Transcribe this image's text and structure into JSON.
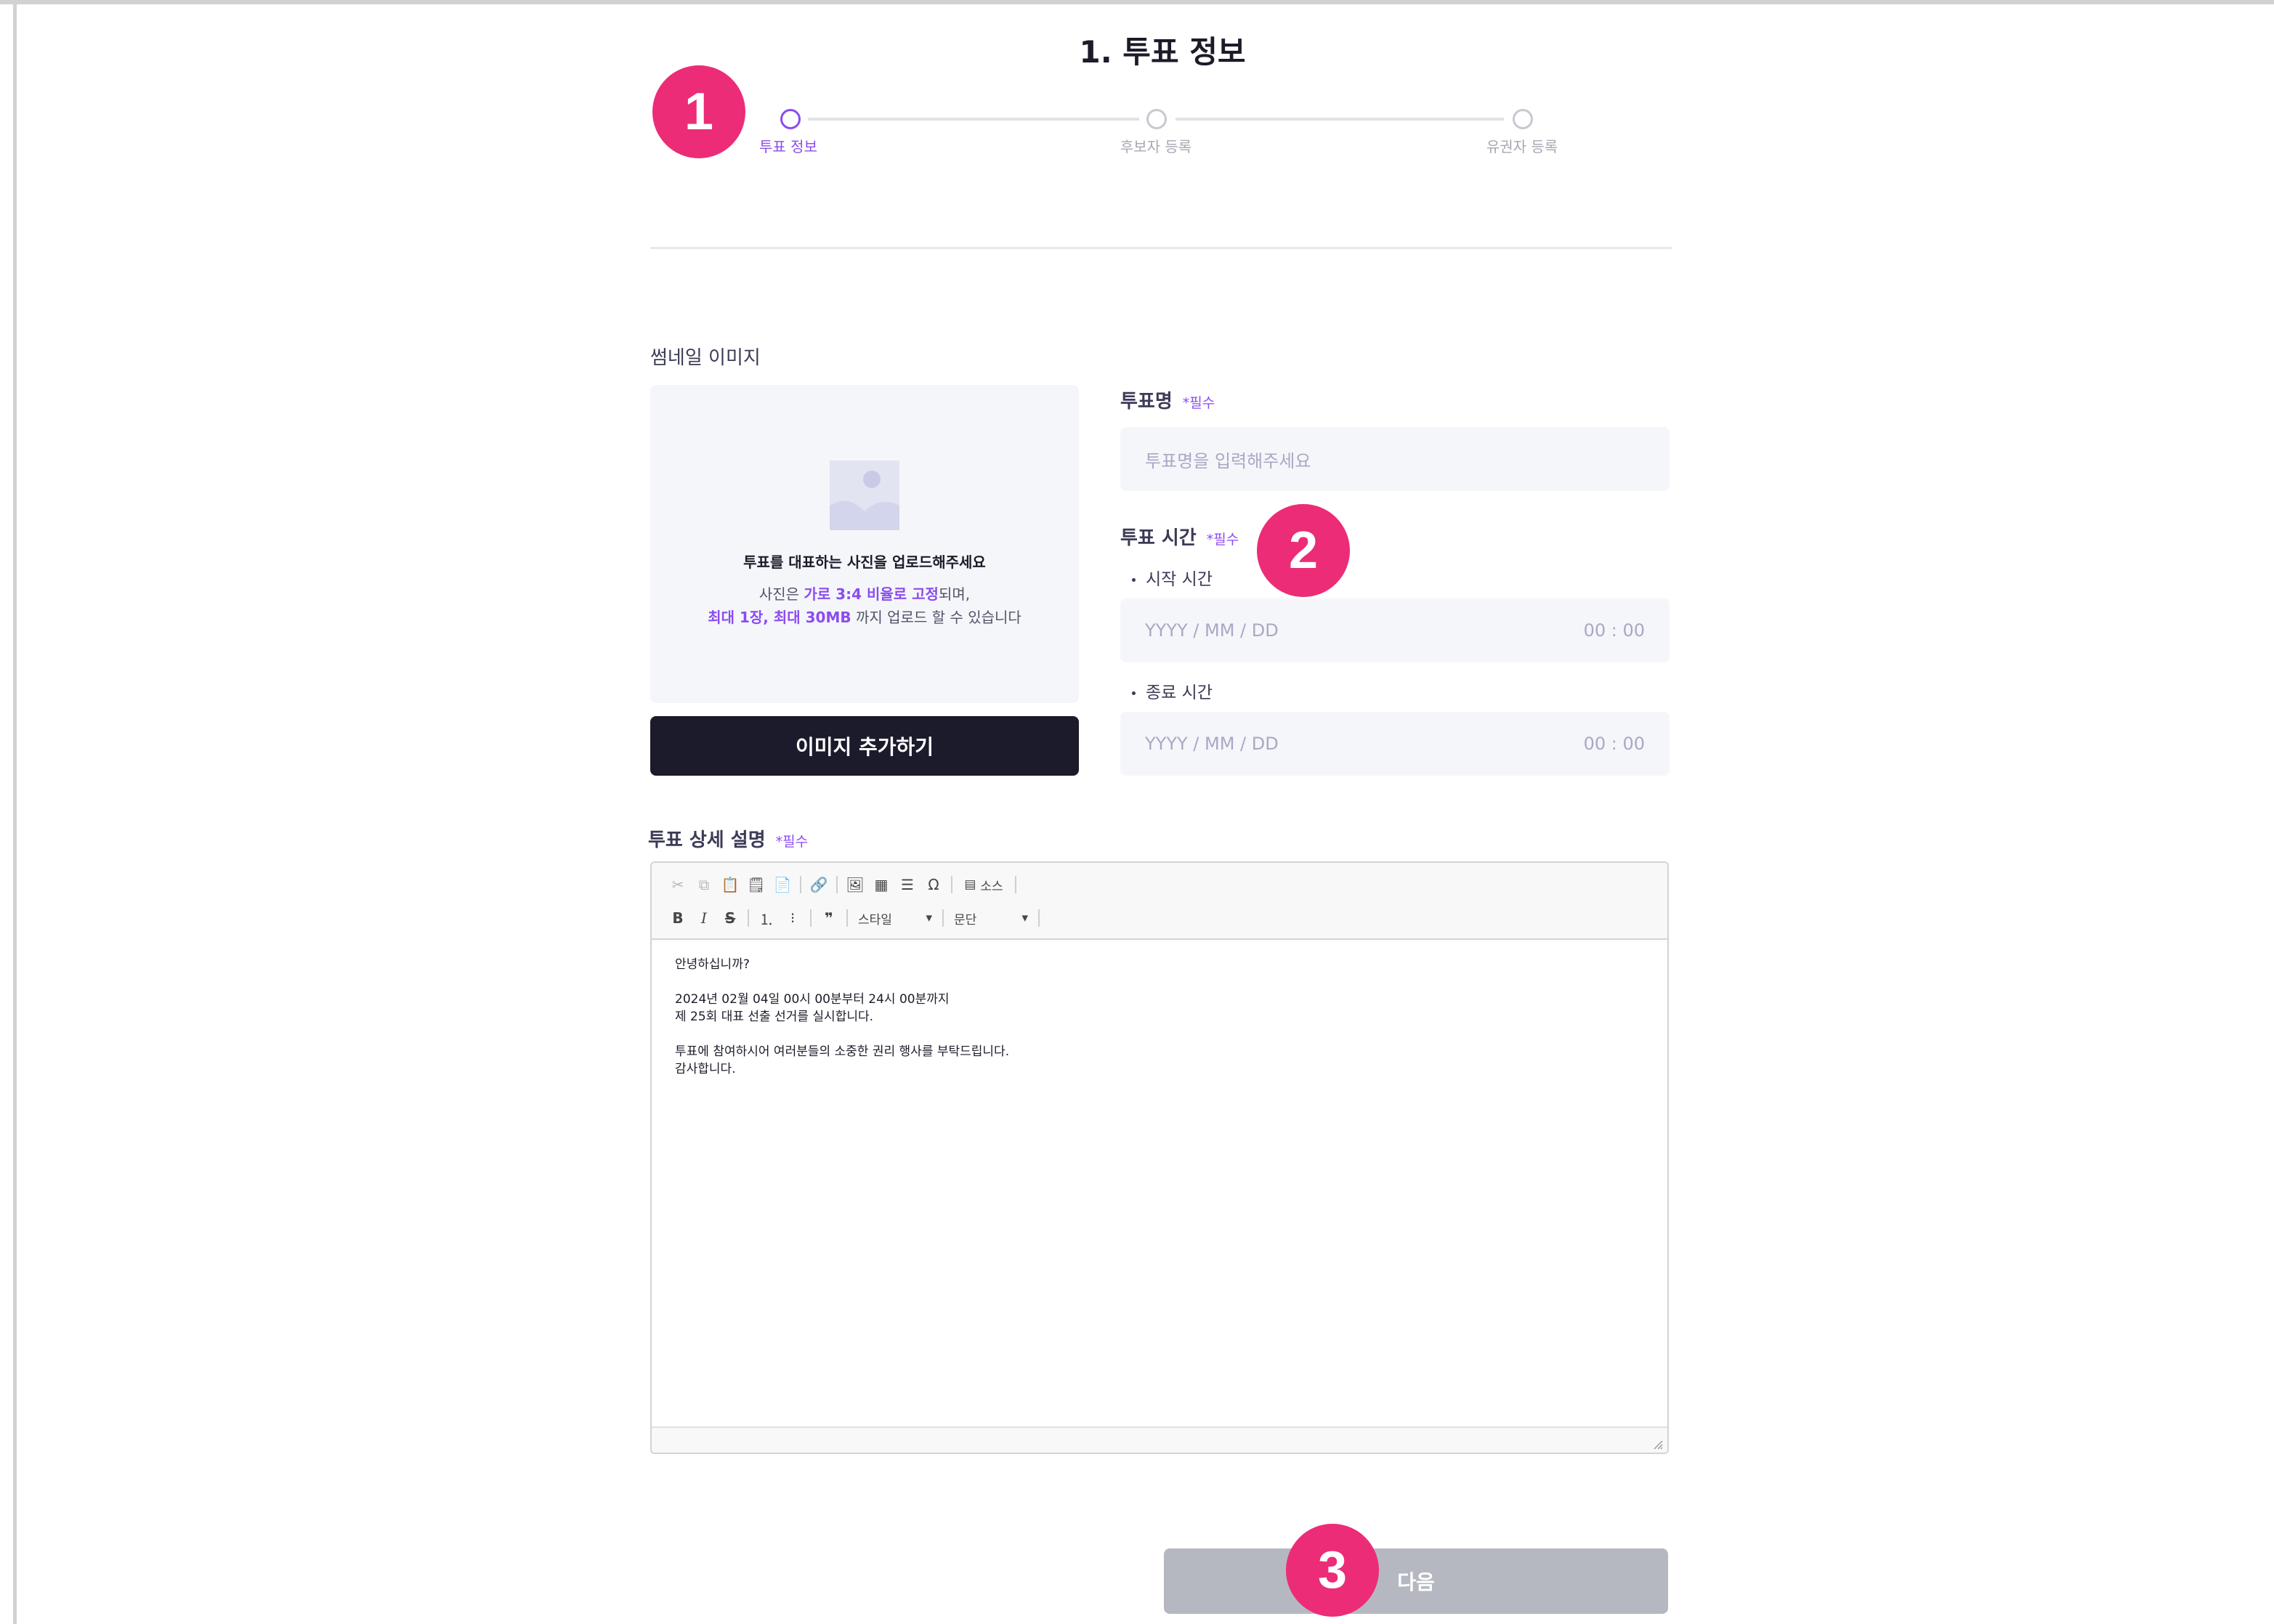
{
  "page": {
    "title": "1. 투표 정보"
  },
  "stepper": {
    "steps": [
      {
        "label": "투표 정보",
        "active": true
      },
      {
        "label": "후보자 등록",
        "active": false
      },
      {
        "label": "유권자 등록",
        "active": false
      }
    ]
  },
  "thumbnail": {
    "label": "썸네일 이미지",
    "icon": "image-placeholder-icon",
    "title": "투표를 대표하는 사진을 업로드해주세요",
    "line1_pre": "사진은 ",
    "line1_highlight": "가로 3:4 비율로 고정",
    "line1_post": "되며,",
    "line2_highlight1": "최대 1장",
    "line2_sep": ", ",
    "line2_highlight2": "최대 30MB",
    "line2_post": " 까지 업로드 할 수 있습니다",
    "button_label": "이미지 추가하기"
  },
  "vote_name": {
    "label": "투표명",
    "required": "*필수",
    "placeholder": "투표명을 입력해주세요"
  },
  "vote_time": {
    "label": "투표 시간",
    "required": "*필수",
    "start_label": "시작 시간",
    "end_label": "종료 시간",
    "date_placeholder": "YYYY / MM / DD",
    "time_placeholder": "00 : 00"
  },
  "description": {
    "label": "투표 상세 설명",
    "required": "*필수",
    "toolbar": {
      "source_label": "소스",
      "style_label": "스타일",
      "format_label": "문단"
    },
    "paragraphs": [
      "안녕하십니까?",
      "2024년 02월 04일 00시 00분부터 24시 00분까지\n제 25회 대표 선출 선거를 실시합니다.",
      "투표에 참여하시어 여러분들의 소중한 권리 행사를 부탁드립니다.\n감사합니다."
    ]
  },
  "next_button": {
    "label": "다음"
  },
  "callouts": [
    "1",
    "2",
    "3"
  ],
  "colors": {
    "accent": "#8b4cf0",
    "callout": "#ec2c77",
    "primary_button": "#1c1b2b",
    "disabled_button": "#b6b8c1",
    "input_bg": "#f5f6fa"
  }
}
